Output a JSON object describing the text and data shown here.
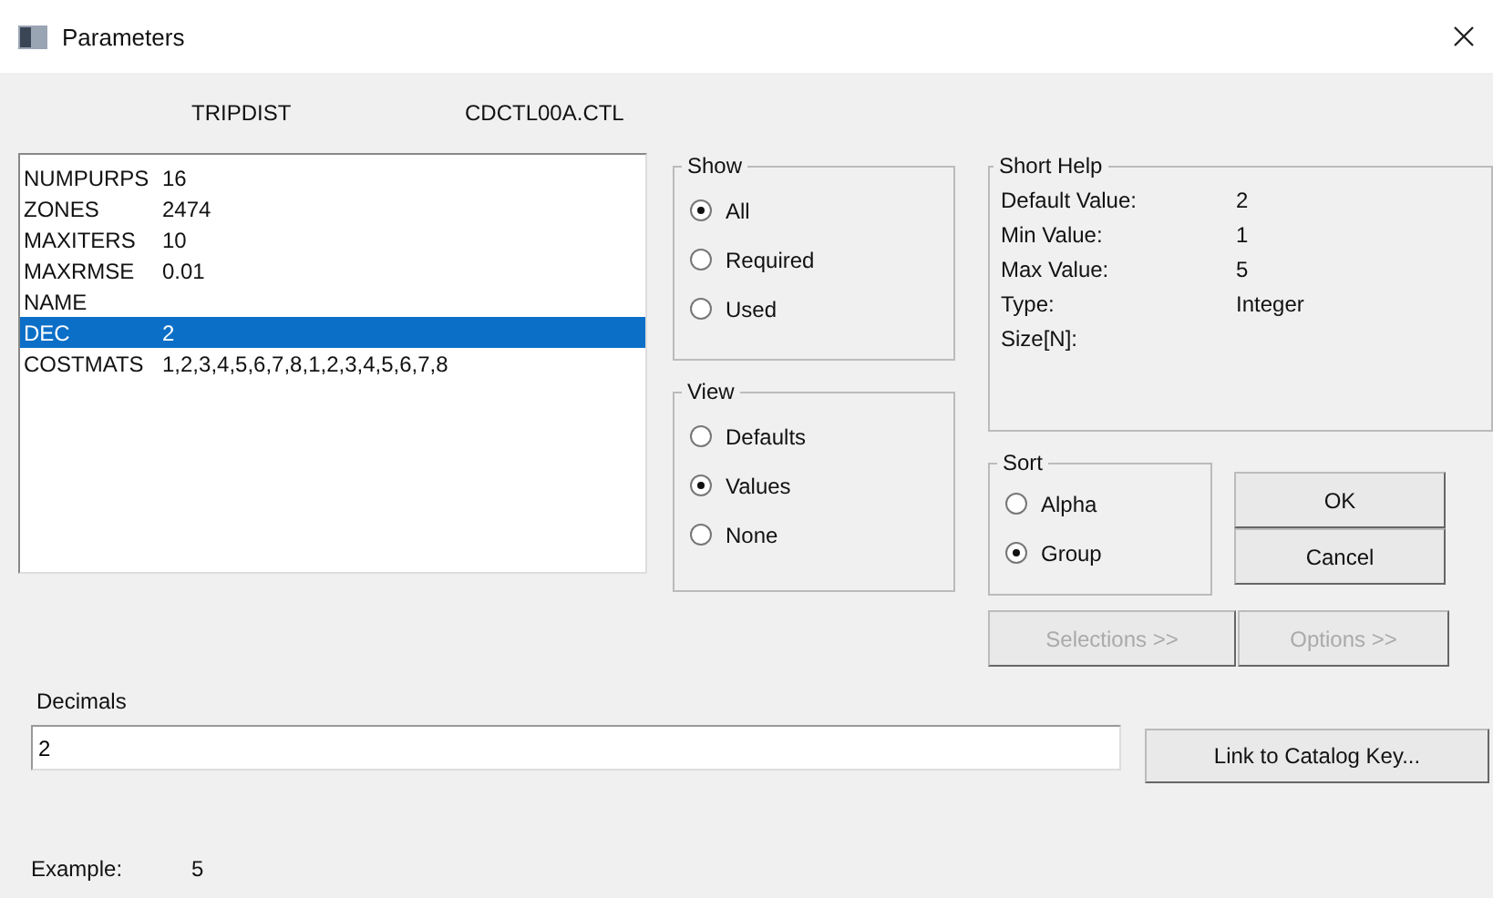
{
  "window": {
    "title": "Parameters"
  },
  "header": [
    "TRIPDIST",
    "CDCTL00A.CTL"
  ],
  "parameters": [
    {
      "name": "NUMPURPS",
      "value": "16",
      "selected": false
    },
    {
      "name": "ZONES",
      "value": "2474",
      "selected": false
    },
    {
      "name": "MAXITERS",
      "value": "10",
      "selected": false
    },
    {
      "name": "MAXRMSE",
      "value": "0.01",
      "selected": false
    },
    {
      "name": "NAME",
      "selected": false
    },
    {
      "name": "DEC",
      "value": "2",
      "selected": true
    },
    {
      "name": "COSTMATS",
      "value": "1,2,3,4,5,6,7,8,1,2,3,4,5,6,7,8",
      "selected": false
    }
  ],
  "show": {
    "title": "Show",
    "options": [
      {
        "label": "All",
        "selected": true
      },
      {
        "label": "Required",
        "selected": false
      },
      {
        "label": "Used",
        "selected": false
      }
    ]
  },
  "view": {
    "title": "View",
    "options": [
      {
        "label": "Defaults",
        "selected": false
      },
      {
        "label": "Values",
        "selected": true
      },
      {
        "label": "None",
        "selected": false
      }
    ]
  },
  "short_help": {
    "title": "Short Help",
    "fields": [
      {
        "label": "Default Value:",
        "value": "2"
      },
      {
        "label": "Min Value:",
        "value": "1"
      },
      {
        "label": "Max Value:",
        "value": "5"
      },
      {
        "label": "Type:",
        "value": "Integer"
      },
      {
        "label": "Size[N]:"
      }
    ]
  },
  "sort": {
    "title": "Sort",
    "options": [
      {
        "label": "Alpha",
        "selected": false
      },
      {
        "label": "Group",
        "selected": true
      }
    ]
  },
  "dialog_buttons": [
    {
      "label": "OK",
      "disabled": false
    },
    {
      "label": "Cancel",
      "disabled": false
    }
  ],
  "more_buttons": [
    {
      "label": "Selections >>",
      "disabled": true
    },
    {
      "label": "Options >>",
      "disabled": true
    }
  ],
  "value_field": {
    "label": "Decimals",
    "value": "2"
  },
  "link_button": {
    "label": "Link to Catalog Key..."
  },
  "example": {
    "label": "Example:",
    "value": "5"
  }
}
